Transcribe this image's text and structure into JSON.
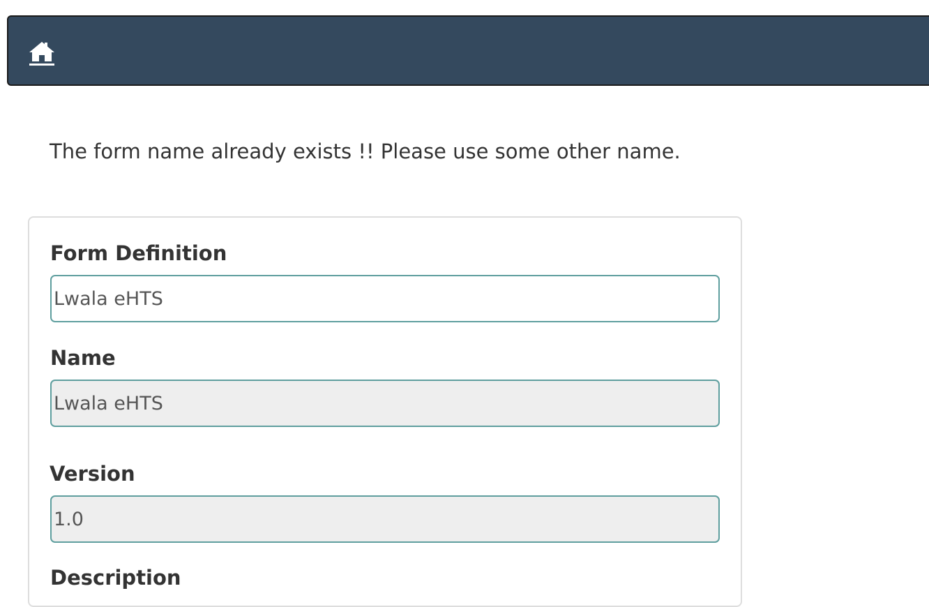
{
  "navbar": {
    "home_icon": "home-icon",
    "background": "#34495e"
  },
  "alert": {
    "message": "The form name already exists !! Please use some other name."
  },
  "form": {
    "form_definition": {
      "label": "Form Definition",
      "value": "Lwala eHTS"
    },
    "name": {
      "label": "Name",
      "value": "Lwala eHTS"
    },
    "version": {
      "label": "Version",
      "value": "1.0"
    },
    "description": {
      "label": "Description"
    }
  },
  "colors": {
    "field_border": "#5e9e9e",
    "readonly_background": "#eeeeee"
  }
}
